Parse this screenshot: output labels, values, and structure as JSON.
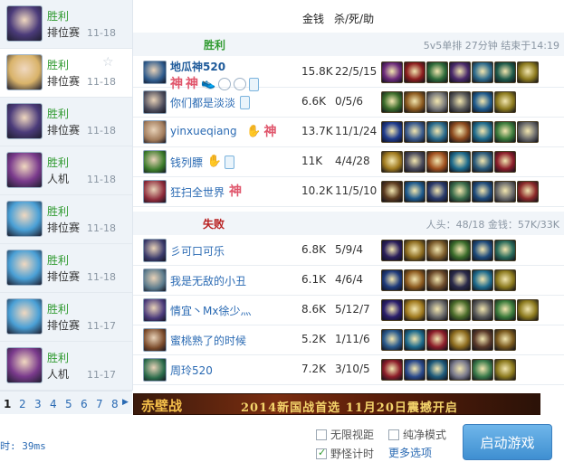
{
  "history": {
    "items": [
      {
        "result": "胜利",
        "mode": "排位赛",
        "date": "11-18",
        "portrait_color": "#4b3b7a",
        "selected": false,
        "starred": false
      },
      {
        "result": "胜利",
        "mode": "排位赛",
        "date": "11-18",
        "portrait_color": "#d9b36a",
        "selected": true,
        "starred": true
      },
      {
        "result": "胜利",
        "mode": "排位赛",
        "date": "11-18",
        "portrait_color": "#4b3b7a",
        "selected": false,
        "starred": false
      },
      {
        "result": "胜利",
        "mode": "人机",
        "date": "11-18",
        "portrait_color": "#7a3a8c",
        "selected": false,
        "starred": false
      },
      {
        "result": "胜利",
        "mode": "排位赛",
        "date": "11-18",
        "portrait_color": "#4aa0d6",
        "selected": false,
        "starred": false
      },
      {
        "result": "胜利",
        "mode": "排位赛",
        "date": "11-18",
        "portrait_color": "#4aa0d6",
        "selected": false,
        "starred": false
      },
      {
        "result": "胜利",
        "mode": "排位赛",
        "date": "11-17",
        "portrait_color": "#4aa0d6",
        "selected": false,
        "starred": false
      },
      {
        "result": "胜利",
        "mode": "人机",
        "date": "11-17",
        "portrait_color": "#7a3a8c",
        "selected": false,
        "starred": false
      }
    ]
  },
  "pager": {
    "pages": [
      "1",
      "2",
      "3",
      "4",
      "5",
      "6",
      "7",
      "8"
    ],
    "current": "1",
    "next_icon": "triangle-right-icon"
  },
  "columns": {
    "gold": "金钱",
    "kda": "杀/死/助"
  },
  "teams": [
    {
      "result": "胜利",
      "result_color": "#2f9a2f",
      "info": "5v5单排 27分钟 结束于14:19",
      "players": [
        {
          "name": "地瓜神520",
          "bold": true,
          "gold": "15.8K",
          "kda": "22/5/15",
          "champ_color": "#2d5a8c",
          "badges": [
            "shen-icon",
            "shen-icon",
            "shoe-icon",
            "cloud-icon",
            "sword-icon",
            "phone-icon"
          ],
          "items": [
            "#6b2a7a",
            "#8c1e1e",
            "#2e6b3a",
            "#4a2a6b",
            "#2d6b8c",
            "#1e5a4a",
            "#8c7a1e"
          ]
        },
        {
          "name": "你们都是淡淡",
          "bold": false,
          "gold": "6.6K",
          "kda": "0/5/6",
          "champ_color": "#4a4a5a",
          "badges": [
            "phone-icon"
          ],
          "items": [
            "#3a6b2a",
            "#8c5a1e",
            "#7a7a7a",
            "#5a5a5a",
            "#1e5a8c",
            "#8c7a1e"
          ]
        },
        {
          "name": "yinxueqiang",
          "bold": false,
          "gold": "13.7K",
          "kda": "11/1/24",
          "champ_color": "#a07a5a",
          "badges": [
            "hand-icon",
            "shen-icon"
          ],
          "items": [
            "#1e3a8c",
            "#3a5a8c",
            "#2a6b8c",
            "#8c4a1e",
            "#1e6b8c",
            "#3a7a3a",
            "#6b6b6b"
          ]
        },
        {
          "name": "钱列膘",
          "bold": false,
          "gold": "11K",
          "kda": "4/4/28",
          "champ_color": "#3a7a2a",
          "badges": [
            "hand-icon",
            "phone-icon"
          ],
          "items": [
            "#a07a1e",
            "#4a4a5a",
            "#a0501e",
            "#1e6b8c",
            "#2a5a7a",
            "#8c1e2a"
          ]
        },
        {
          "name": "狂扫全世界",
          "bold": false,
          "gold": "10.2K",
          "kda": "11/5/10",
          "champ_color": "#8c2a3a",
          "badges": [
            "shen-icon"
          ],
          "items": [
            "#5a3a1e",
            "#1e5a8c",
            "#2a3a6b",
            "#3a6b4a",
            "#1e4a7a",
            "#6b6b6b",
            "#8c2a2a"
          ]
        }
      ]
    },
    {
      "result": "失败",
      "result_color": "#b81e1e",
      "info": "人头：48/18 金钱：57K/33K",
      "players": [
        {
          "name": "彡可口可乐",
          "bold": false,
          "gold": "6.8K",
          "kda": "5/9/4",
          "champ_color": "#3a3a6b",
          "badges": [],
          "items": [
            "#2a1e5a",
            "#8c6b1e",
            "#7a5a2a",
            "#3a6b2a",
            "#1e4a7a",
            "#2a6b5a"
          ]
        },
        {
          "name": "我是无敌的小丑",
          "bold": false,
          "gold": "6.1K",
          "kda": "4/6/4",
          "champ_color": "#5a7a8c",
          "badges": [],
          "items": [
            "#1e3a7a",
            "#8c5a1e",
            "#6b4a2a",
            "#2a2a4a",
            "#1e6b8c",
            "#8c7a1e"
          ]
        },
        {
          "name": "情宜丶Mx徐少灬",
          "bold": false,
          "gold": "8.6K",
          "kda": "5/12/7",
          "champ_color": "#4a3a7a",
          "badges": [],
          "items": [
            "#2a1e6b",
            "#a07a1e",
            "#6b6b6b",
            "#4a6b2a",
            "#5a5a5a",
            "#3a7a3a",
            "#8c7a1e"
          ]
        },
        {
          "name": "蜜桃熟了的时候",
          "bold": false,
          "gold": "5.2K",
          "kda": "1/11/6",
          "champ_color": "#7a4a2a",
          "badges": [],
          "items": [
            "#2a5a8c",
            "#1e6b8c",
            "#8c1e2a",
            "#8c6b1e",
            "#5a3a2a",
            "#7a5a1e"
          ]
        },
        {
          "name": "周玲520",
          "bold": false,
          "gold": "7.2K",
          "kda": "3/10/5",
          "champ_color": "#2a6b4a",
          "badges": [],
          "items": [
            "#8c1e2a",
            "#2a4a8c",
            "#1e5a7a",
            "#7a7a8c",
            "#3a7a4a",
            "#8c7a1e"
          ]
        }
      ]
    }
  ],
  "banner": {
    "logo": "赤壁战",
    "text": "2014新国战首选 11月20日震撼开启"
  },
  "footer": {
    "latency": "时: 39ms",
    "options": [
      {
        "label": "无限视距",
        "checked": false
      },
      {
        "label": "纯净模式",
        "checked": false
      },
      {
        "label": "野怪计时",
        "checked": true
      }
    ],
    "more_options": "更多选项",
    "start_button": "启动游戏"
  }
}
